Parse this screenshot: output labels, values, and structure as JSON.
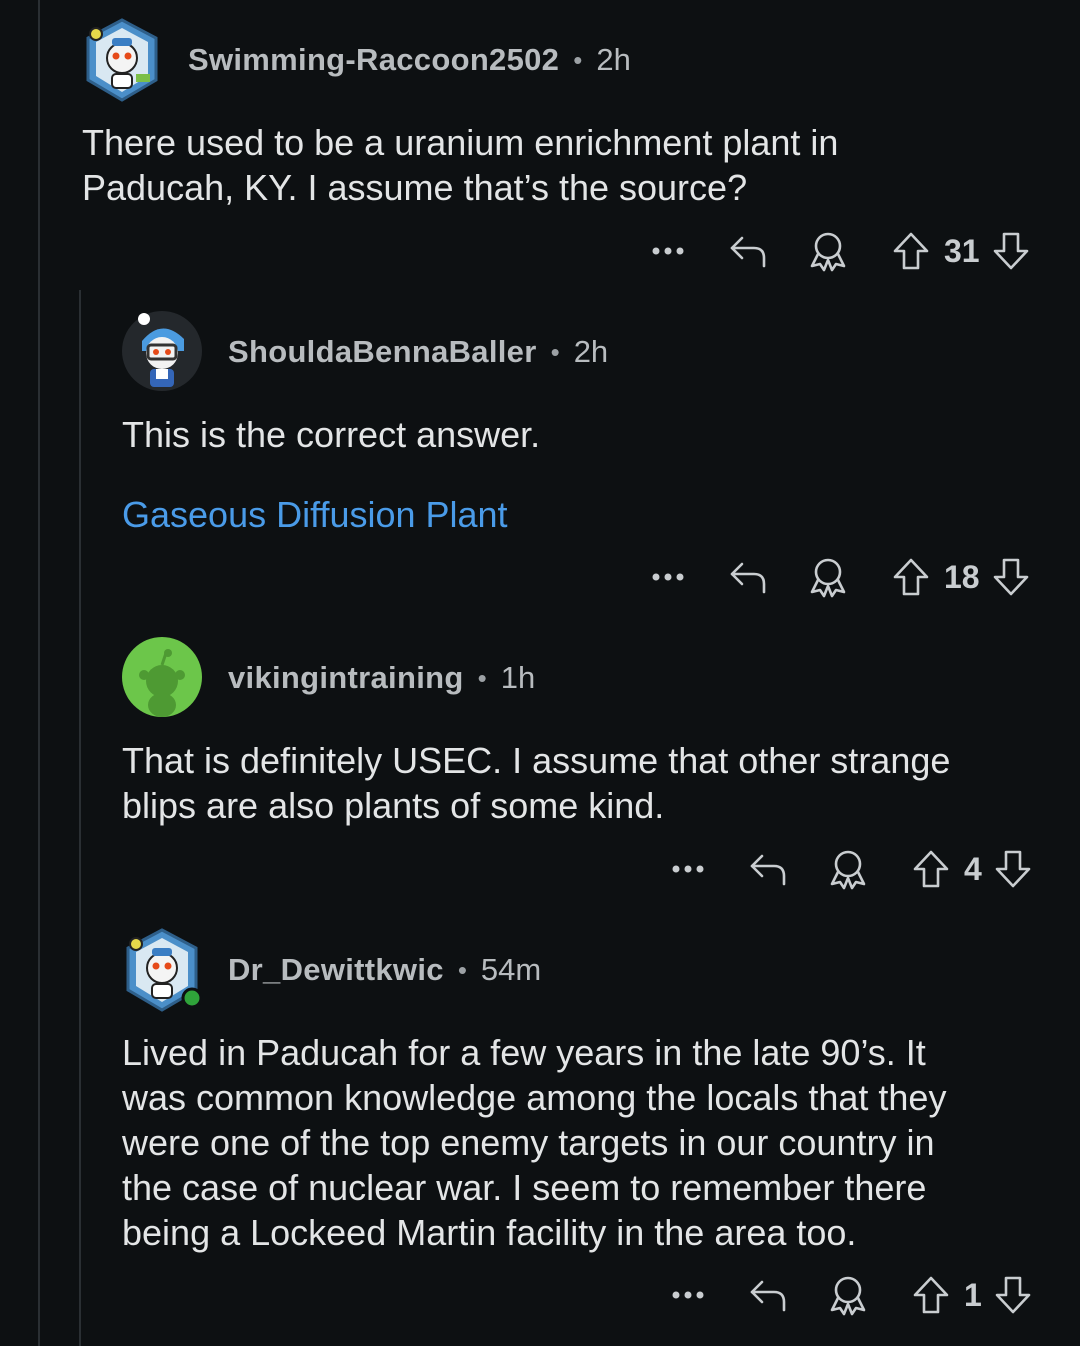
{
  "comments": [
    {
      "username": "Swimming-Raccoon2502",
      "time": "2h",
      "body_lines": [
        "There used to be a uranium enrichment plant in",
        "Paducah, KY. I assume that’s the source?"
      ],
      "score": "31",
      "avatar_icon": "snoo-robot-avatar-icon"
    },
    {
      "username": "ShouldaBennaBaller",
      "time": "2h",
      "body_lines": [
        "This is the correct answer."
      ],
      "link": "Gaseous Diffusion Plant",
      "score": "18",
      "avatar_icon": "snoo-football-avatar-icon"
    },
    {
      "username": "vikingintraining",
      "time": "1h",
      "body_lines": [
        "That is definitely USEC. I assume that other strange",
        "blips are also plants of some kind."
      ],
      "score": "4",
      "avatar_icon": "default-green-snoo-avatar-icon"
    },
    {
      "username": "Dr_Dewittkwic",
      "time": "54m",
      "body_lines": [
        "Lived in Paducah for a few years in the late 90’s. It",
        "was common knowledge among the locals that they",
        "were one of the top enemy targets in our country in",
        "the case of nuclear war. I seem to remember there",
        "being a Lockeed Martin facility in the area too."
      ],
      "score": "1",
      "avatar_icon": "snoo-robot-avatar-online-icon"
    }
  ],
  "separator": "•",
  "colors": {
    "background": "#0d1012",
    "link": "#4a9be8",
    "online": "#2fa33a"
  }
}
